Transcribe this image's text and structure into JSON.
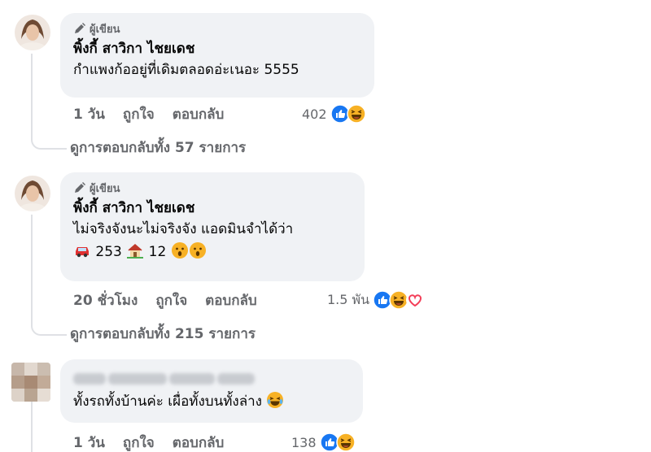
{
  "comments": [
    {
      "badge": "ผู้เขียน",
      "author": "พิ้งกี้ สาวิกา ไชยเดช",
      "line1": "กำแพงก้ออยู่ที่เดิมตลอดอ่ะเนอะ 5555",
      "time": "1 วัน",
      "like": "ถูกใจ",
      "reply": "ตอบกลับ",
      "reaction_count": "402",
      "reactions": [
        "like",
        "haha"
      ],
      "view_replies": "ดูการตอบกลับทั้ง 57 รายการ"
    },
    {
      "badge": "ผู้เขียน",
      "author": "พิ้งกี้ สาวิกา ไชยเดช",
      "line1": "ไม่จริงจังนะไม่จริงจัง แอดมินจำได้ว่า",
      "car_count": "253",
      "house_count": "12",
      "time": "20 ชั่วโมง",
      "like": "ถูกใจ",
      "reply": "ตอบกลับ",
      "reaction_count": "1.5 พัน",
      "reactions": [
        "like",
        "haha",
        "love"
      ],
      "view_replies": "ดูการตอบกลับทั้ง 215 รายการ"
    },
    {
      "line1": "ทั้งรถทั้งบ้านค่ะ เผื่อทั้งบนทั้งล่าง",
      "time": "1 วัน",
      "like": "ถูกใจ",
      "reply": "ตอบกลับ",
      "reaction_count": "138",
      "reactions": [
        "like",
        "haha"
      ]
    }
  ],
  "colors": {
    "bubble": "#f0f2f5",
    "meta": "#65676b",
    "like_blue": "#1877f2",
    "haha_yellow": "#f7b125",
    "love_red": "#f33e58"
  }
}
